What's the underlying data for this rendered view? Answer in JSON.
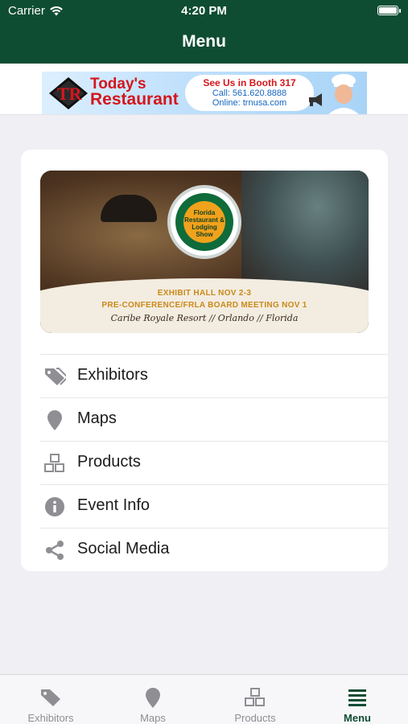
{
  "status_bar": {
    "carrier": "Carrier",
    "time": "4:20 PM"
  },
  "header": {
    "title": "Menu"
  },
  "ad_banner": {
    "brand_line1": "Today's",
    "brand_line2": "Restaurant",
    "logo_text": "TR",
    "callout": "See Us in Booth 317",
    "phone": "Call: 561.620.8888",
    "online": "Online: trnusa.com"
  },
  "hero": {
    "seal_text": "Florida Restaurant & Lodging Show",
    "line1": "EXHIBIT HALL NOV 2-3",
    "line2": "PRE-CONFERENCE/FRLA BOARD MEETING NOV 1",
    "line3": "Caribe Royale Resort // Orlando // Florida"
  },
  "menu": {
    "items": [
      {
        "label": "Exhibitors",
        "icon": "tags-icon"
      },
      {
        "label": "Maps",
        "icon": "map-marker-icon"
      },
      {
        "label": "Products",
        "icon": "cubes-icon"
      },
      {
        "label": "Event Info",
        "icon": "info-circle-icon"
      },
      {
        "label": "Social Media",
        "icon": "share-icon"
      }
    ]
  },
  "tabbar": {
    "tabs": [
      {
        "label": "Exhibitors",
        "icon": "tags-icon",
        "active": false
      },
      {
        "label": "Maps",
        "icon": "map-marker-icon",
        "active": false
      },
      {
        "label": "Products",
        "icon": "cubes-icon",
        "active": false
      },
      {
        "label": "Menu",
        "icon": "menu-icon",
        "active": true
      }
    ]
  },
  "colors": {
    "header_bg": "#0f4d33",
    "accent": "#0f4d33",
    "icon_gray": "#8e8e93",
    "page_bg": "#efeff4"
  }
}
